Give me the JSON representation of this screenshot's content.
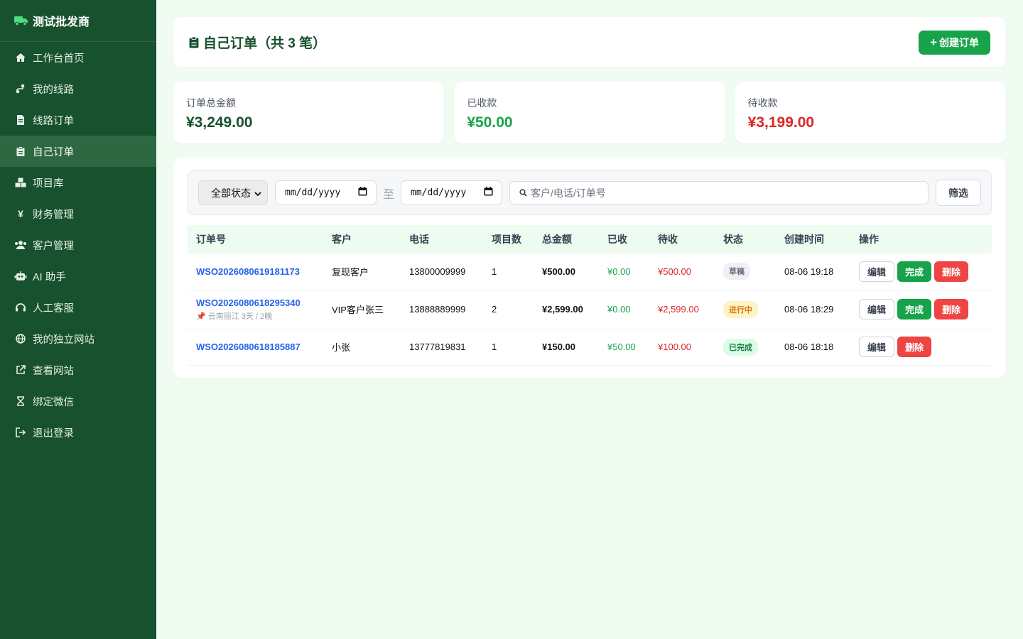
{
  "sidebar": {
    "brand": "测试批发商",
    "items": [
      {
        "label": "工作台首页",
        "icon": "home-icon"
      },
      {
        "label": "我的线路",
        "icon": "route-icon"
      },
      {
        "label": "线路订单",
        "icon": "document-icon"
      },
      {
        "label": "自己订单",
        "icon": "clipboard-icon",
        "active": true
      },
      {
        "label": "项目库",
        "icon": "cubes-icon"
      },
      {
        "label": "财务管理",
        "icon": "yen-icon"
      },
      {
        "label": "客户管理",
        "icon": "users-icon"
      },
      {
        "label": "AI 助手",
        "icon": "robot-icon"
      },
      {
        "label": "人工客服",
        "icon": "headset-icon"
      },
      {
        "label": "我的独立网站",
        "icon": "globe-icon"
      },
      {
        "label": "查看网站",
        "icon": "external-link-icon"
      },
      {
        "label": "绑定微信",
        "icon": "hourglass-icon"
      },
      {
        "label": "退出登录",
        "icon": "logout-icon"
      }
    ]
  },
  "header": {
    "title": "自己订单（共 3 笔）",
    "create_button": "创建订单"
  },
  "stats": {
    "total_label": "订单总金额",
    "total_value": "¥3,249.00",
    "received_label": "已收款",
    "received_value": "¥50.00",
    "pending_label": "待收款",
    "pending_value": "¥3,199.00"
  },
  "filter": {
    "status_selected": "全部状态",
    "date_from_placeholder": "mm/dd/yyyy",
    "date_to_placeholder": "mm/dd/yyyy",
    "to_label": "至",
    "search_placeholder": "客户/电话/订单号",
    "filter_button": "筛选"
  },
  "table": {
    "headers": [
      "订单号",
      "客户",
      "电话",
      "项目数",
      "总金额",
      "已收",
      "待收",
      "状态",
      "创建时间",
      "操作"
    ],
    "rows": [
      {
        "order_no": "WSO2026080619181173",
        "sub": "",
        "customer": "复现客户",
        "phone": "13800009999",
        "items": "1",
        "total": "¥500.00",
        "received": "¥0.00",
        "pending": "¥500.00",
        "status": "草稿",
        "created": "08-06 19:18",
        "edit": "编辑",
        "complete": "完成",
        "delete": "删除"
      },
      {
        "order_no": "WSO2026080618295340",
        "sub": "📌 云南丽江 3天 / 2晚",
        "customer": "VIP客户张三",
        "phone": "13888889999",
        "items": "2",
        "total": "¥2,599.00",
        "received": "¥0.00",
        "pending": "¥2,599.00",
        "status": "进行中",
        "created": "08-06 18:29",
        "edit": "编辑",
        "complete": "完成",
        "delete": "删除"
      },
      {
        "order_no": "WSO2026080618185887",
        "sub": "",
        "customer": "小张",
        "phone": "13777819831",
        "items": "1",
        "total": "¥150.00",
        "received": "¥50.00",
        "pending": "¥100.00",
        "status": "已完成",
        "created": "08-06 18:18",
        "edit": "编辑",
        "delete": "删除"
      }
    ]
  },
  "colors": {
    "sidebar_bg": "#17512d",
    "accent_green": "#16a34a",
    "danger_red": "#dc2626",
    "link_blue": "#2563eb"
  }
}
